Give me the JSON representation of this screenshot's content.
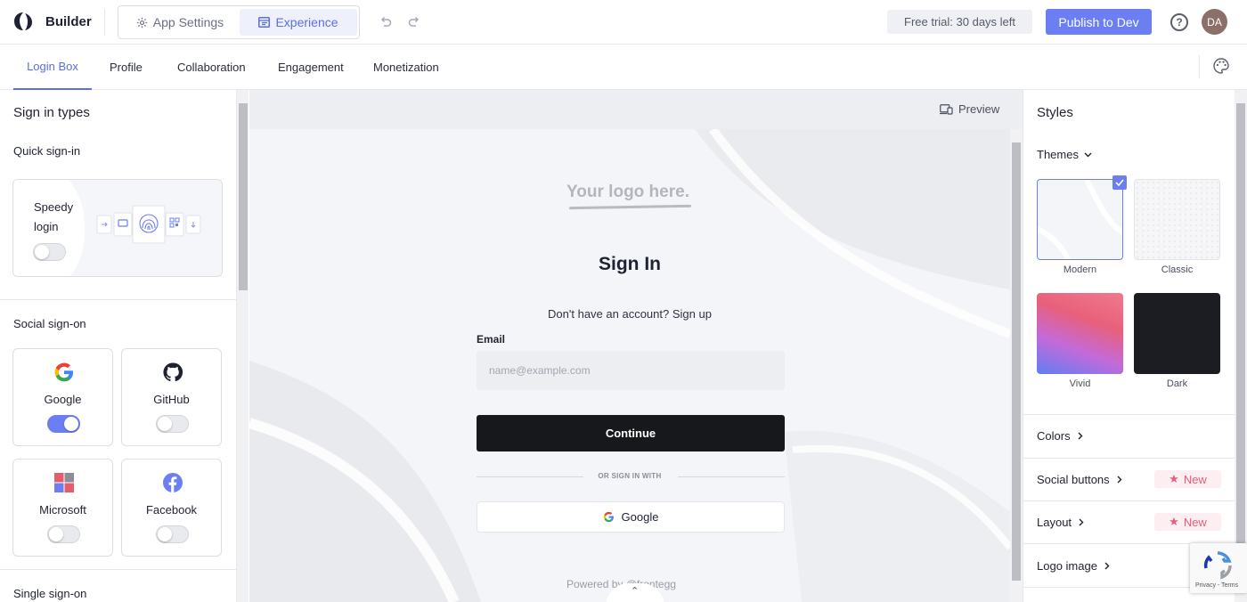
{
  "header": {
    "app_title": "Builder",
    "mode_tabs": [
      {
        "label": "App Settings",
        "icon": "gear-icon",
        "active": false
      },
      {
        "label": "Experience",
        "icon": "layout-icon",
        "active": true
      }
    ],
    "trial_badge": "Free trial: 30 days left",
    "publish_label": "Publish to Dev",
    "help_icon": "help-icon",
    "avatar_initials": "DA"
  },
  "tabs": [
    {
      "label": "Login Box",
      "active": true
    },
    {
      "label": "Profile",
      "active": false
    },
    {
      "label": "Collaboration",
      "active": false
    },
    {
      "label": "Engagement",
      "active": false
    },
    {
      "label": "Monetization",
      "active": false
    }
  ],
  "left_panel": {
    "title": "Sign in types",
    "quick_signin": {
      "heading": "Quick sign-in",
      "speedy_label": "Speedy login",
      "speedy_enabled": false
    },
    "social": {
      "heading": "Social sign-on",
      "providers": [
        {
          "label": "Google",
          "icon": "google-icon",
          "enabled": true
        },
        {
          "label": "GitHub",
          "icon": "github-icon",
          "enabled": false
        },
        {
          "label": "Microsoft",
          "icon": "microsoft-icon",
          "enabled": false
        },
        {
          "label": "Facebook",
          "icon": "facebook-icon",
          "enabled": false
        }
      ]
    },
    "sso_heading": "Single sign-on"
  },
  "preview": {
    "preview_label": "Preview",
    "logo_placeholder": "Your logo here.",
    "signin_title": "Sign In",
    "signup_prompt": "Don't have an account? Sign up",
    "email_label": "Email",
    "email_placeholder": "name@example.com",
    "continue_label": "Continue",
    "or_text": "OR SIGN IN WITH",
    "google_label": "Google",
    "powered_by": "Powered by  @frontegg"
  },
  "right_panel": {
    "title": "Styles",
    "themes_heading": "Themes",
    "themes": [
      {
        "label": "Modern",
        "selected": true
      },
      {
        "label": "Classic",
        "selected": false
      },
      {
        "label": "Vivid",
        "selected": false
      },
      {
        "label": "Dark",
        "selected": false
      }
    ],
    "sections": [
      {
        "label": "Colors",
        "badge": ""
      },
      {
        "label": "Social buttons",
        "badge": "New"
      },
      {
        "label": "Layout",
        "badge": "New"
      },
      {
        "label": "Logo image",
        "badge": ""
      }
    ]
  },
  "recaptcha_text": "Privacy - Terms",
  "colors": {
    "accent": "#6b7ff2",
    "badge_text": "#e45f7b",
    "dark_button": "#17181c"
  }
}
